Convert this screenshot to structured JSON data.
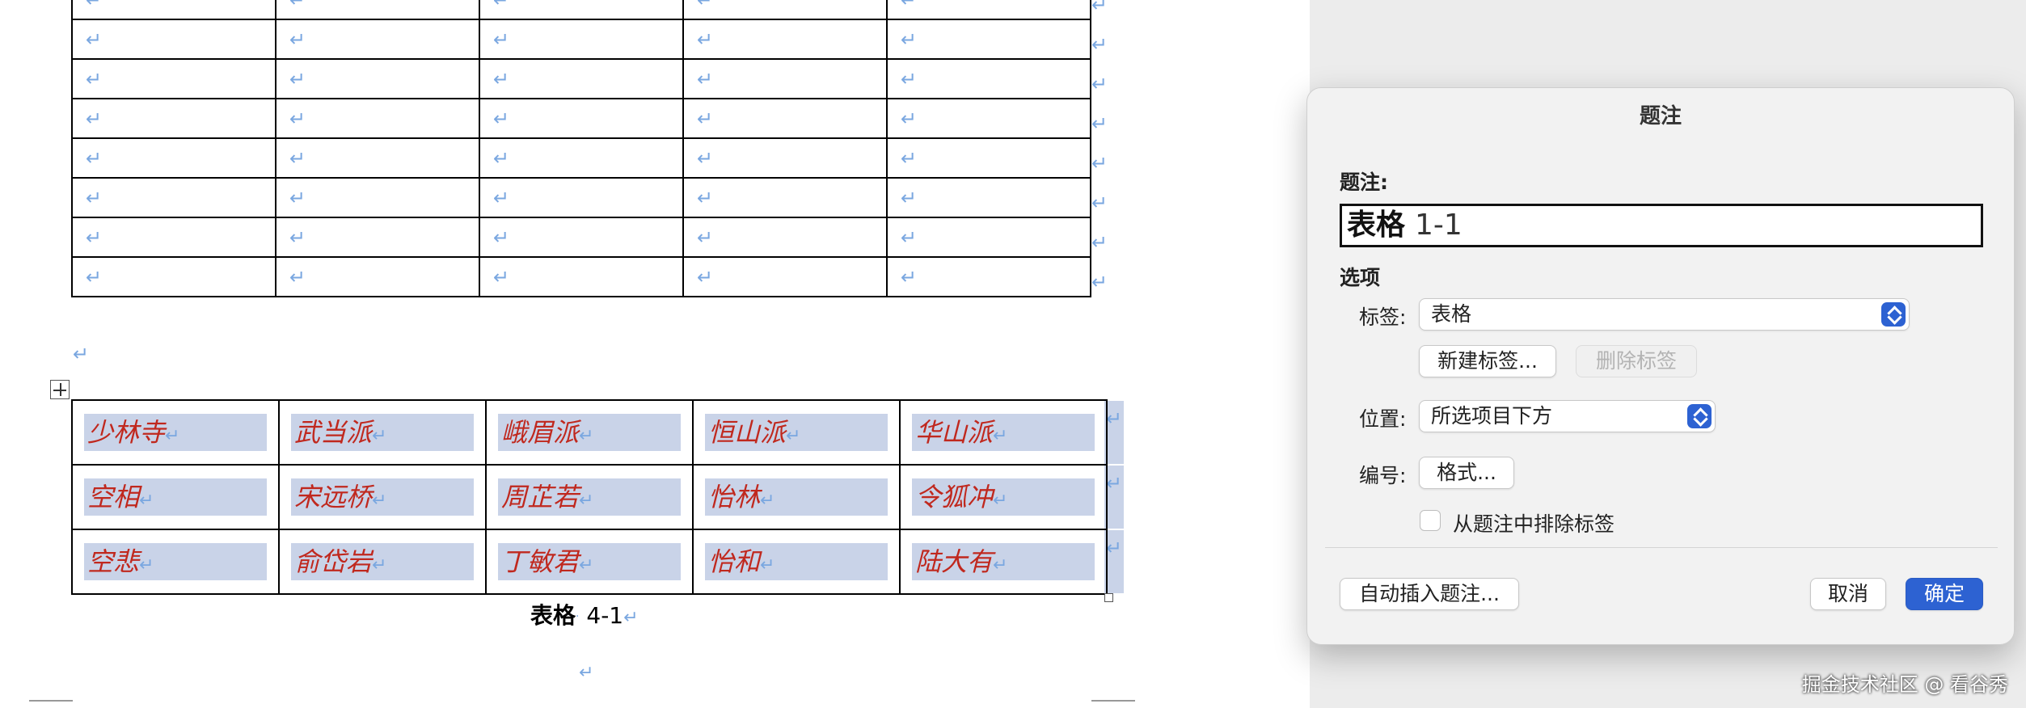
{
  "document": {
    "paragraph_mark": "↵",
    "empty_table": {
      "rows": 8,
      "cols": 5
    },
    "data_table": {
      "rows": [
        [
          "少林寺",
          "武当派",
          "峨眉派",
          "恒山派",
          "华山派"
        ],
        [
          "空相",
          "宋远桥",
          "周芷若",
          "怡林",
          "令狐冲"
        ],
        [
          "空悲",
          "俞岱岩",
          "丁敏君",
          "怡和",
          "陆大有"
        ]
      ]
    },
    "caption": {
      "label": "表格",
      "number": "4-1"
    }
  },
  "dialog": {
    "title": "题注",
    "caption_label": "题注:",
    "caption_value_label": "表格",
    "caption_value_number": "1-1",
    "options_heading": "选项",
    "tag_label": "标签:",
    "tag_value": "表格",
    "new_tag_button": "新建标签...",
    "delete_tag_button": "删除标签",
    "position_label": "位置:",
    "position_value": "所选项目下方",
    "numbering_label": "编号:",
    "format_button": "格式...",
    "exclude_label_text": "从题注中排除标签",
    "autoinsert_button": "自动插入题注...",
    "cancel_button": "取消",
    "ok_button": "确定",
    "accent_color": "#2d62d2"
  },
  "watermark": "掘金技术社区 @ 看谷秀"
}
